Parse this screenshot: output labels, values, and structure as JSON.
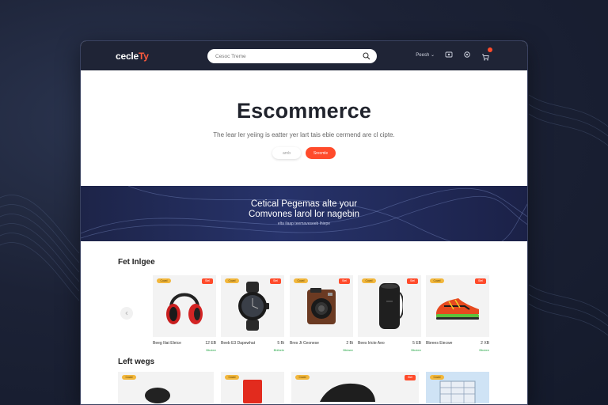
{
  "header": {
    "logo_main": "cecle",
    "logo_accent": "Ty",
    "search_placeholder": "Cesoc Treme",
    "nav_link": "Peesh ⌄"
  },
  "hero": {
    "title": "Escommerce",
    "subtitle": "The lear ler yeiing is eatter yer lart tais ebie cermend are cl cipte.",
    "btn_secondary": "arnb",
    "btn_primary": "Srecmle"
  },
  "banner": {
    "line1": "Cetical Pegemas alte your",
    "line2": "Comvones larol lor nagebin",
    "line3": "elta ilaap teemaveseeb lhiepe"
  },
  "sections": {
    "featured_title": "Fet Inlgee",
    "second_title": "Left wegs"
  },
  "products": [
    {
      "name": "Beeg Iliat Eleice",
      "price": "12 EB",
      "stock": "Bbutee",
      "badge": "Cowd",
      "sale": "Stel"
    },
    {
      "name": "Beeb E3 Dapewhat",
      "price": "5 Bi",
      "stock": "Bblbele",
      "badge": "Cowd",
      "sale": "Stel"
    },
    {
      "name": "Bres Jt Ceonese",
      "price": "2 Bi",
      "stock": "Bbtaee",
      "badge": "Cowd",
      "sale": "Stel"
    },
    {
      "name": "Bees Iricte Aeo",
      "price": "5 EB",
      "stock": "Bbutee",
      "badge": "Cowd",
      "sale": "Stel"
    },
    {
      "name": "Bbrees Eiecwe",
      "price": "2 XB",
      "stock": "Bbutee",
      "badge": "Cowd",
      "sale": "Stel"
    }
  ],
  "colors": {
    "accent": "#ff4b2b",
    "topbar": "#1f2436",
    "banner": "#27336b",
    "in_stock": "#2aa84a"
  }
}
